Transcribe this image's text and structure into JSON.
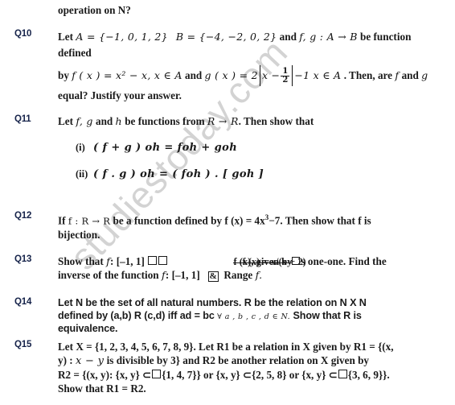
{
  "document": {
    "watermark": "studiestoday.com",
    "header_fragment": "operation on N?"
  },
  "questions": [
    {
      "id": "q10",
      "label": "Q10",
      "lead": "Let",
      "set_a": "A = {−1, 0, 1, 2}",
      "set_b": "B = {−4, −2, 0, 2}",
      "conj_and": "and",
      "map": "f, g : A → B",
      "tail1": "be function defined",
      "by": "by",
      "fx": "f ( x ) = x² − x, x ∈ A",
      "conj_and2": "and",
      "gx_pre": "g ( x ) = 2",
      "gx_inner_left": "x −",
      "gx_num": "1",
      "gx_den": "2",
      "gx_post": "−1 x ∈ A",
      "tail2": ". Then, are",
      "f_sym": "f",
      "and3": "and",
      "g_sym": "g",
      "tail3": "equal? Justify your answer."
    },
    {
      "id": "q11",
      "label": "Q11",
      "lead": "Let",
      "fg": "f, g",
      "and1": "and",
      "h": "h",
      "mid": "be functions from",
      "domain": "R → R",
      "tail": ". Then show that",
      "subitems": [
        {
          "num": "(i)",
          "eq": "( f + g ) oh = foh + goh"
        },
        {
          "num": "(ii)",
          "eq": "( f . g ) oh = ( foh ) . [ goh ]"
        }
      ]
    },
    {
      "id": "q12",
      "label": "Q12",
      "lead": "If",
      "map": "f : R → R",
      "line1": "be a function defined by f (x) = 4x",
      "exponent": "3",
      "line1b": "−7. Then show that f is",
      "line2": "bijection."
    },
    {
      "id": "q13",
      "label": "Q13",
      "line1_a": "Show that",
      "line1_f": "f",
      "line1_b": ": [–1, 1]",
      "garbled_layer1": "f (x), given by",
      "garbled_layer2": "f (x) = x/(x + 2)",
      "line1_c": "s one-one. Find the",
      "line2_a": "inverse of the function",
      "line2_f": "f",
      "line2_b": ": [–1, 1]",
      "amp": "&",
      "line2_c": "Range",
      "line2_f2": "f."
    },
    {
      "id": "q14",
      "label": "Q14",
      "line1": "Let N be the set of all natural numbers. R be the relation on N X N",
      "line2_a": "defined by (a,b) R (c,d) iff ad = bc",
      "quantifier": "∀ a , b , c , d ∈ N.",
      "line2_b": "Show that R is",
      "line3": "equivalence."
    },
    {
      "id": "q15",
      "label": "Q15",
      "line1": "Let X = {1, 2, 3, 4, 5, 6, 7, 8, 9}. Let R1 be a relation in X given by R1 = {(x,",
      "line2_a": "y) :",
      "line2_x": "x − y",
      "line2_b": "is divisible by 3} and R2 be another relation on X given by",
      "line3_a": "R2 = {(x, y): {x, y} ⊂",
      "line3_b": "{1, 4, 7}} or  {x, y} ⊂{2, 5, 8} or {x, y} ⊂",
      "line3_c": "{3, 6, 9}}.",
      "line4": "Show that R1 = R2."
    }
  ]
}
